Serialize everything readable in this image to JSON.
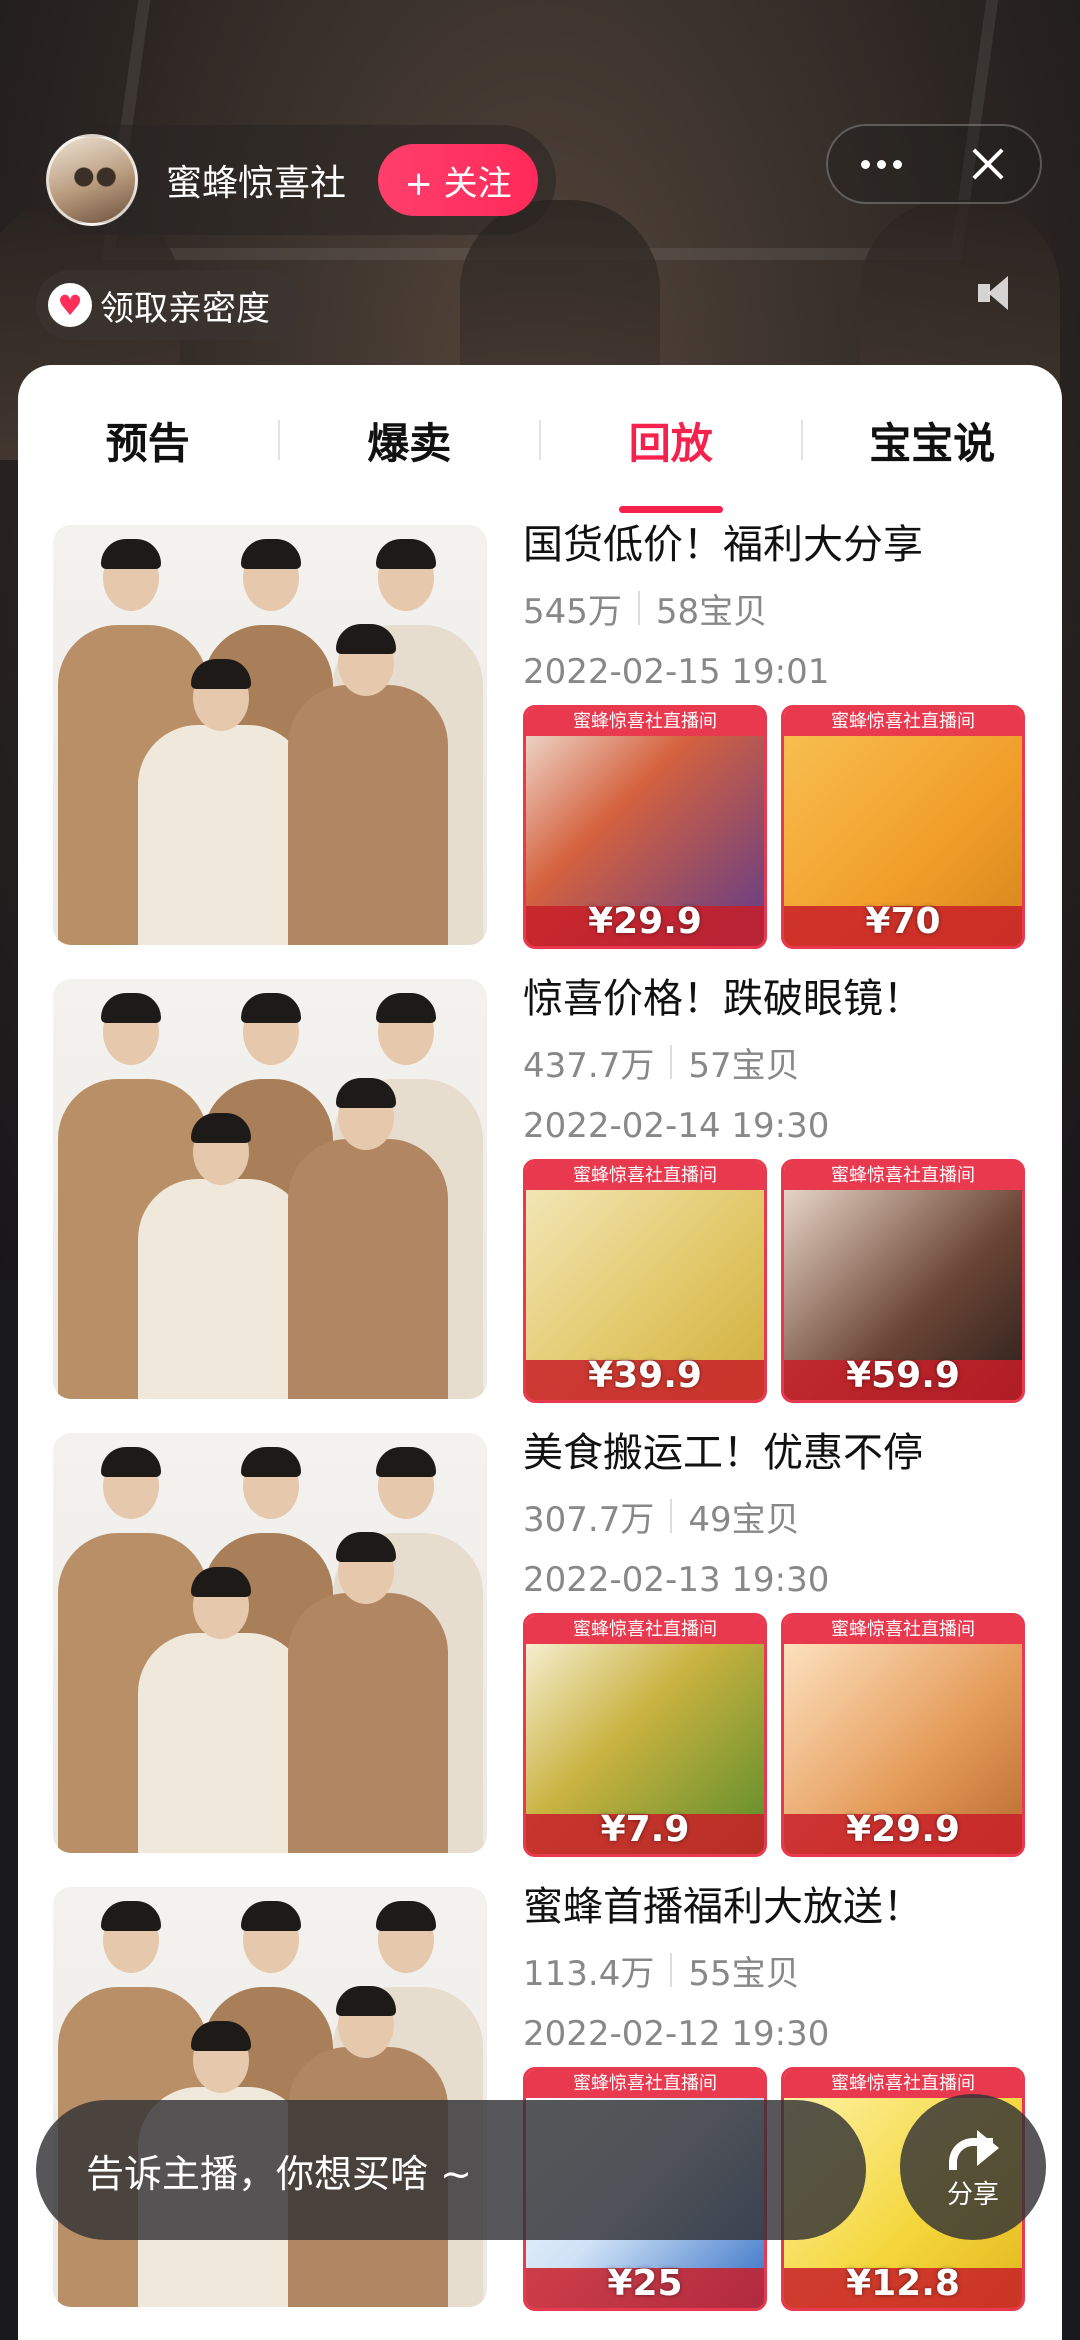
{
  "host": {
    "name": "蜜蜂惊喜社",
    "follow_label": "+ 关注",
    "intimacy_label": "领取亲密度"
  },
  "tabs": [
    {
      "label": "预告",
      "active": false
    },
    {
      "label": "爆卖",
      "active": false
    },
    {
      "label": "回放",
      "active": true
    },
    {
      "label": "宝宝说",
      "active": false
    }
  ],
  "accent_color": "#f5224d",
  "replays": [
    {
      "title": "国货低价！福利大分享",
      "views": "545万",
      "items": "58宝贝",
      "date": "2022-02-15 19:01",
      "products": [
        {
          "banner": "蜜蜂惊喜社直播间",
          "price": "¥29.9"
        },
        {
          "banner": "蜜蜂惊喜社直播间",
          "price": "¥70"
        }
      ]
    },
    {
      "title": "惊喜价格！跌破眼镜！",
      "views": "437.7万",
      "items": "57宝贝",
      "date": "2022-02-14 19:30",
      "products": [
        {
          "banner": "蜜蜂惊喜社直播间",
          "price": "¥39.9"
        },
        {
          "banner": "蜜蜂惊喜社直播间",
          "price": "¥59.9"
        }
      ]
    },
    {
      "title": "美食搬运工！优惠不停",
      "views": "307.7万",
      "items": "49宝贝",
      "date": "2022-02-13 19:30",
      "products": [
        {
          "banner": "蜜蜂惊喜社直播间",
          "price": "¥7.9"
        },
        {
          "banner": "蜜蜂惊喜社直播间",
          "price": "¥29.9"
        }
      ]
    },
    {
      "title": "蜜蜂首播福利大放送！",
      "views": "113.4万",
      "items": "55宝贝",
      "date": "2022-02-12 19:30",
      "products": [
        {
          "banner": "蜜蜂惊喜社直播间",
          "price": "¥25"
        },
        {
          "banner": "蜜蜂惊喜社直播间",
          "price": "¥12.8"
        }
      ]
    }
  ],
  "comment": {
    "placeholder": "告诉主播，你想买啥 ~"
  },
  "share_label": "分享"
}
